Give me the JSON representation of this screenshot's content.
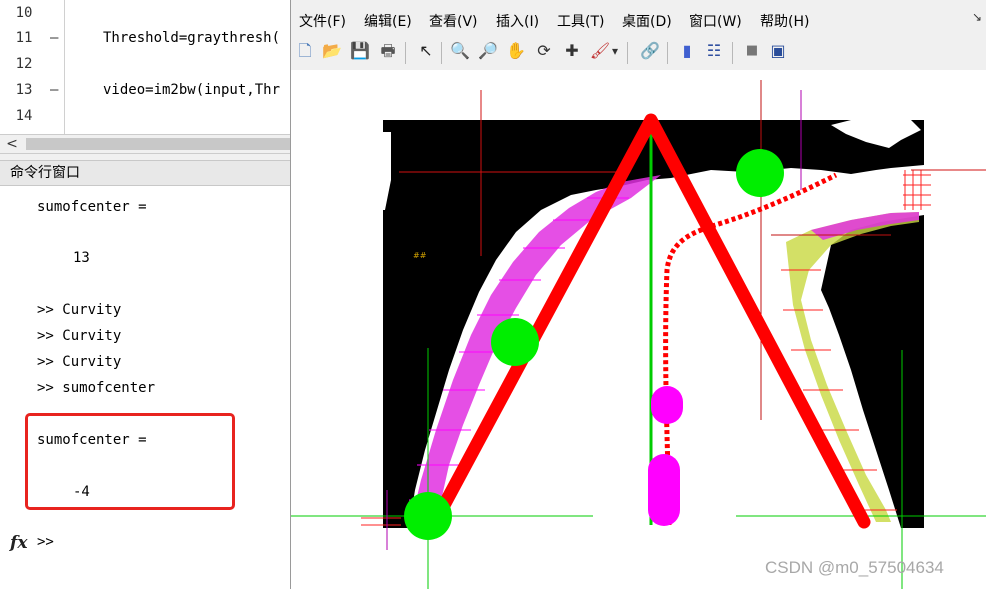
{
  "editor": {
    "lines": [
      {
        "num": "10",
        "dash": "",
        "code": ""
      },
      {
        "num": "11",
        "dash": "—",
        "code": "Threshold=graythresh("
      },
      {
        "num": "12",
        "dash": "",
        "code": ""
      },
      {
        "num": "13",
        "dash": "—",
        "code": "video=im2bw(input,Thr"
      },
      {
        "num": "14",
        "dash": "",
        "code": ""
      }
    ],
    "scroll_left_arrow": "<"
  },
  "command_window": {
    "title": "命令行窗口",
    "lines": [
      {
        "text": "sumofcenter =",
        "indent": false
      },
      {
        "text": "13",
        "indent": true
      },
      {
        "text": ">> Curvity",
        "indent": false
      },
      {
        "text": ">> Curvity",
        "indent": false
      },
      {
        "text": ">> Curvity",
        "indent": false
      },
      {
        "text": ">> sumofcenter",
        "indent": false
      },
      {
        "text": "sumofcenter =",
        "indent": false
      },
      {
        "text": "-4",
        "indent": true
      }
    ],
    "fx_label": "fx",
    "prompt": ">>"
  },
  "figure": {
    "menus": [
      "文件(F)",
      "编辑(E)",
      "查看(V)",
      "插入(I)",
      "工具(T)",
      "桌面(D)",
      "窗口(W)",
      "帮助(H)"
    ],
    "toolbar": [
      {
        "name": "new-figure-icon",
        "glyph": "🗋"
      },
      {
        "name": "open-file-icon",
        "glyph": "📂"
      },
      {
        "name": "save-icon",
        "glyph": "💾"
      },
      {
        "name": "print-icon",
        "glyph": "🖶"
      },
      {
        "name": "edit-plot-arrow-icon",
        "glyph": "↖"
      },
      {
        "name": "zoom-in-icon",
        "glyph": "🔍"
      },
      {
        "name": "zoom-out-icon",
        "glyph": "🔎"
      },
      {
        "name": "pan-hand-icon",
        "glyph": "✋"
      },
      {
        "name": "rotate-3d-icon",
        "glyph": "⟳"
      },
      {
        "name": "data-cursor-icon",
        "glyph": "✚"
      },
      {
        "name": "brush-icon",
        "glyph": "🖌"
      },
      {
        "name": "brush-dropdown-icon",
        "glyph": "▾"
      },
      {
        "name": "link-plot-icon",
        "glyph": "🔗"
      },
      {
        "name": "colorbar-icon",
        "glyph": "▮"
      },
      {
        "name": "legend-icon",
        "glyph": "☷"
      },
      {
        "name": "hide-plot-tools-icon",
        "glyph": "■"
      },
      {
        "name": "show-plot-tools-icon",
        "glyph": "▣"
      }
    ],
    "minimize_glyph": "↘",
    "colors": {
      "lane_red": "#ff0000",
      "marker_green": "#00ee00",
      "marker_magenta": "#ff00ff",
      "center_green": "#00cc00"
    }
  },
  "watermark": "CSDN @m0_57504634"
}
